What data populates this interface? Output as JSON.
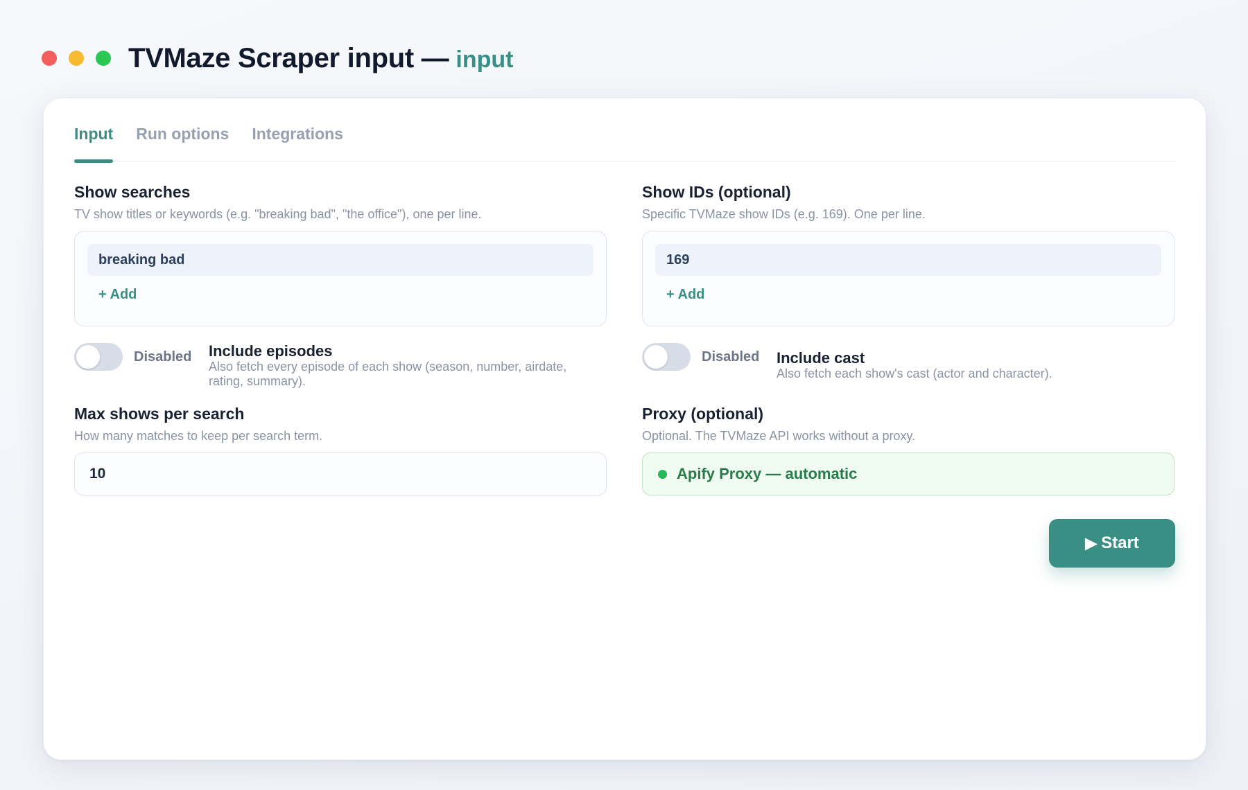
{
  "window": {
    "title": "TVMaze Scraper input —",
    "subtitle": "input"
  },
  "tabs": [
    {
      "label": "Input",
      "active": true
    },
    {
      "label": "Run options",
      "active": false
    },
    {
      "label": "Integrations",
      "active": false
    }
  ],
  "show_searches": {
    "label": "Show searches",
    "help": "TV show titles or keywords (e.g. \"breaking bad\", \"the office\"), one per line.",
    "items": [
      "breaking bad"
    ],
    "add_label": "+ Add"
  },
  "show_ids": {
    "label": "Show IDs (optional)",
    "help": "Specific TVMaze show IDs (e.g. 169). One per line.",
    "items": [
      "169"
    ],
    "add_label": "+ Add"
  },
  "include_episodes": {
    "state": "Disabled",
    "enabled": false,
    "title": "Include episodes",
    "description": "Also fetch every episode of each show (season, number, airdate, rating, summary)."
  },
  "include_cast": {
    "state": "Disabled",
    "enabled": false,
    "title": "Include cast",
    "description": "Also fetch each show's cast (actor and character)."
  },
  "max_shows": {
    "label": "Max shows per search",
    "help": "How many matches to keep per search term.",
    "value": "10"
  },
  "proxy": {
    "label": "Proxy (optional)",
    "help": "Optional. The TVMaze API works without a proxy.",
    "value": "Apify Proxy — automatic",
    "status_color": "#28b65a"
  },
  "actions": {
    "start_icon": "▶",
    "start_label": "Start"
  },
  "colors": {
    "accent": "#3a8f84",
    "window_red": "#f15e5b",
    "window_yellow": "#f6bb30",
    "window_green": "#2bc653"
  }
}
